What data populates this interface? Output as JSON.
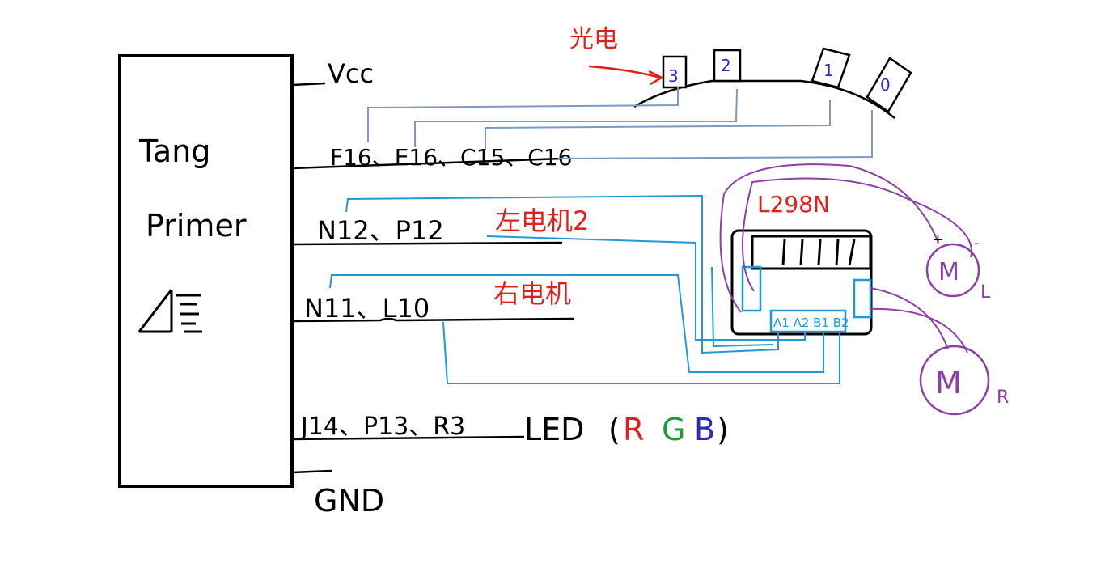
{
  "board": {
    "name_line1": "Tang",
    "name_line2": "Primer",
    "logo": "anlogic-logo"
  },
  "pins": {
    "vcc": "Vcc",
    "sensors": "F16、E16、C15、C16",
    "motor_left": "N12、P12",
    "motor_right": "N11、L10",
    "led": "J14、P13、R3",
    "gnd": "GND"
  },
  "notes": {
    "motor_left": "左电机2",
    "motor_right": "右电机",
    "light_sensor": "光电"
  },
  "led_label": {
    "prefix": "LED",
    "open": "(",
    "r": "R",
    "g": "G",
    "b": "B",
    "close": ")"
  },
  "sensors": [
    "3",
    "2",
    "1",
    "0"
  ],
  "driver": {
    "name": "L298N",
    "inputs": "A1 A2 B1 B2"
  },
  "motors": {
    "left": {
      "symbol": "M",
      "tag": "L",
      "plus": "+",
      "minus": "-"
    },
    "right": {
      "symbol": "M",
      "tag": "R"
    }
  },
  "colors": {
    "ink": "#000000",
    "note_red": "#e0201b",
    "sensor_wire": "#7d99bf",
    "signal_wire": "#1f9ad6",
    "motor_wire": "#8e3fa6",
    "led_r": "#e0201b",
    "led_g": "#1b9e3a",
    "led_b": "#2c2cb8",
    "sensor_digit": "#2c2cb8"
  }
}
